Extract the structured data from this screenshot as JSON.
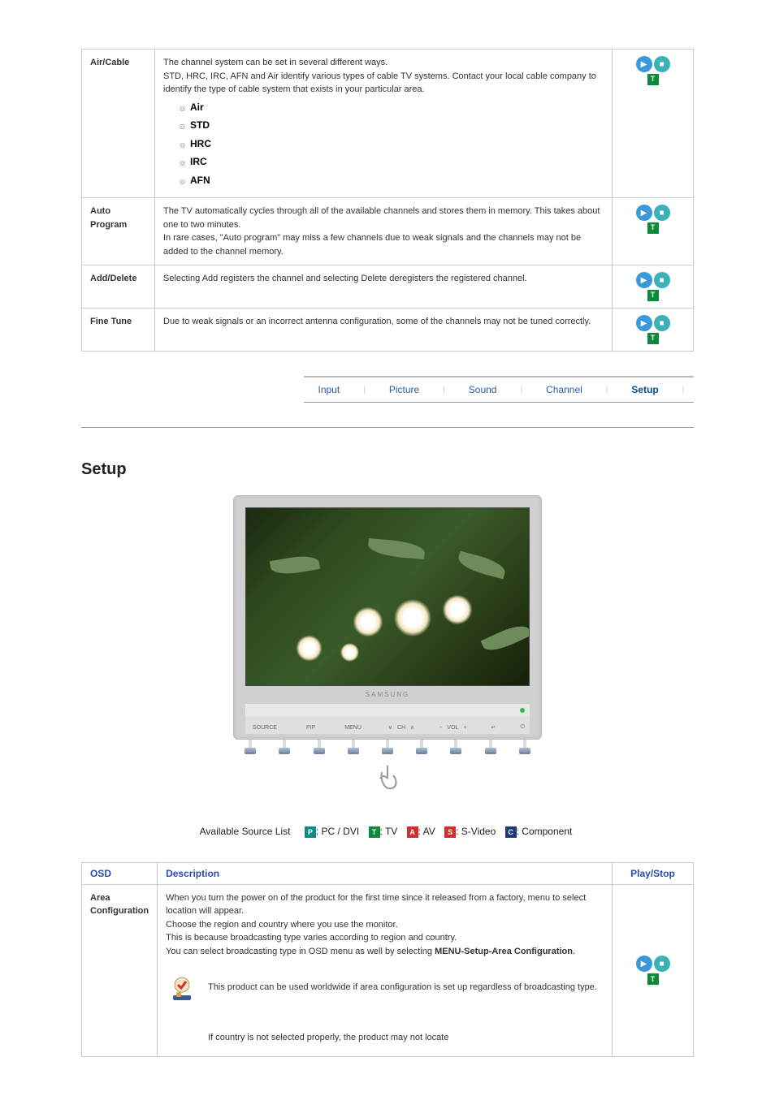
{
  "channel_table": [
    {
      "name": "Air/Cable",
      "desc_intro": "The channel system can be set in several different ways.\nSTD, HRC, IRC, AFN and Air identify various types of cable TV systems. Contact your local cable company to identify the type of cable system that exists in your particular area.",
      "options": [
        "Air",
        "STD",
        "HRC",
        "IRC",
        "AFN"
      ]
    },
    {
      "name": "Auto Program",
      "desc": "The TV automatically cycles through all of the available channels and stores them in memory. This takes about one to two minutes.\nIn rare cases, \"Auto program\" may miss a few channels due to weak signals and the channels may not be added to the channel memory."
    },
    {
      "name": "Add/Delete",
      "desc": "Selecting Add registers the channel and selecting Delete deregisters the registered channel."
    },
    {
      "name": "Fine Tune",
      "desc": "Due to weak signals or an incorrect antenna configuration, some of the channels may not be tuned correctly."
    }
  ],
  "tabs": {
    "items": [
      "Input",
      "Picture",
      "Sound",
      "Channel",
      "Setup"
    ],
    "active": "Setup"
  },
  "section_title": "Setup",
  "monitor": {
    "brand": "SAMSUNG",
    "controls": {
      "source": "SOURCE",
      "pip": "PIP",
      "menu": "MENU",
      "ch": "CH",
      "vol": "VOL"
    }
  },
  "source_list": {
    "label": "Available Source List",
    "items": [
      {
        "badge": "P",
        "color": "teal",
        "text": ": PC / DVI"
      },
      {
        "badge": "T",
        "color": "green",
        "text": ": TV"
      },
      {
        "badge": "A",
        "color": "red",
        "text": ": AV"
      },
      {
        "badge": "S",
        "color": "red",
        "text": ": S-Video"
      },
      {
        "badge": "C",
        "color": "navy",
        "text": ": Component"
      }
    ]
  },
  "setup_table": {
    "headers": {
      "osd": "OSD",
      "desc": "Description",
      "play": "Play/Stop"
    },
    "rows": [
      {
        "name": "Area Configuration",
        "desc_line": "When you turn the power on of the product for the first time since it released from a factory, menu to select location will appear.\nChoose the region and country where you use the monitor.\nThis is because broadcasting type varies according to region and country.\nYou can select broadcasting type in OSD menu as well by selecting ",
        "desc_bold": "MENU-Setup-Area Configuration",
        "desc_suffix": ".",
        "note1": "This product can be used worldwide if area configuration is set up regardless of broadcasting type.",
        "note2": "If country is not selected properly, the product may not locate"
      }
    ]
  }
}
